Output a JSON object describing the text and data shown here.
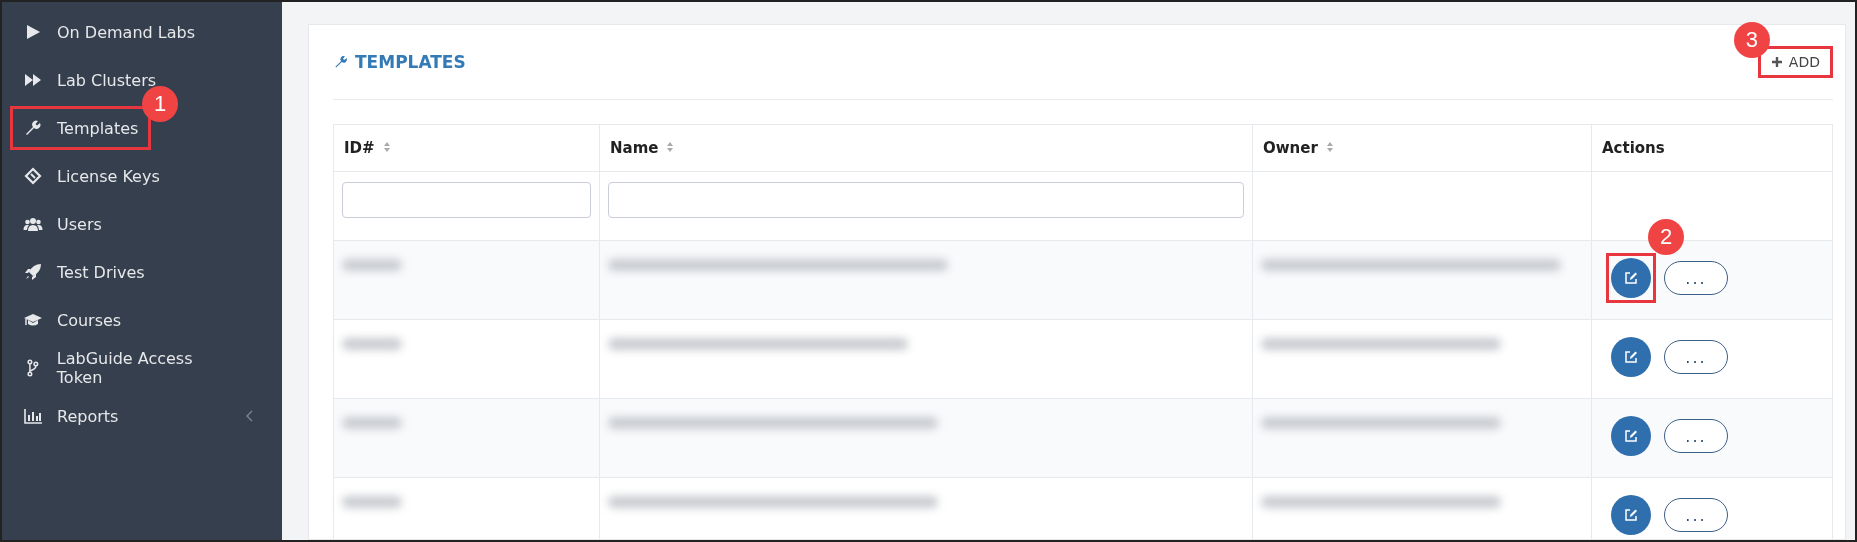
{
  "sidebar": {
    "items": [
      {
        "label": "On Demand Labs",
        "selected": false,
        "submenu": false
      },
      {
        "label": "Lab Clusters",
        "selected": false,
        "submenu": false
      },
      {
        "label": "Templates",
        "selected": true,
        "callout": "1",
        "submenu": false
      },
      {
        "label": "License Keys",
        "selected": false,
        "submenu": false
      },
      {
        "label": "Users",
        "selected": false,
        "submenu": false
      },
      {
        "label": "Test Drives",
        "selected": false,
        "submenu": false
      },
      {
        "label": "Courses",
        "selected": false,
        "submenu": false
      },
      {
        "label": "LabGuide Access Token",
        "selected": false,
        "submenu": false
      },
      {
        "label": "Reports",
        "selected": false,
        "submenu": true
      }
    ]
  },
  "panel": {
    "title": "TEMPLATES",
    "add_button": {
      "label": "ADD",
      "callout": "3"
    }
  },
  "table": {
    "columns": [
      {
        "label": "ID#",
        "sortable": true,
        "filter": true
      },
      {
        "label": "Name",
        "sortable": true,
        "filter": true
      },
      {
        "label": "Owner",
        "sortable": true,
        "filter": false
      },
      {
        "label": "Actions",
        "sortable": false,
        "filter": false
      }
    ],
    "rows": [
      {
        "kind": "redacted",
        "more_label": "...",
        "callout": "2"
      },
      {
        "kind": "redacted",
        "more_label": "..."
      },
      {
        "kind": "redacted",
        "more_label": "..."
      },
      {
        "kind": "redacted",
        "more_label": "..."
      }
    ]
  }
}
